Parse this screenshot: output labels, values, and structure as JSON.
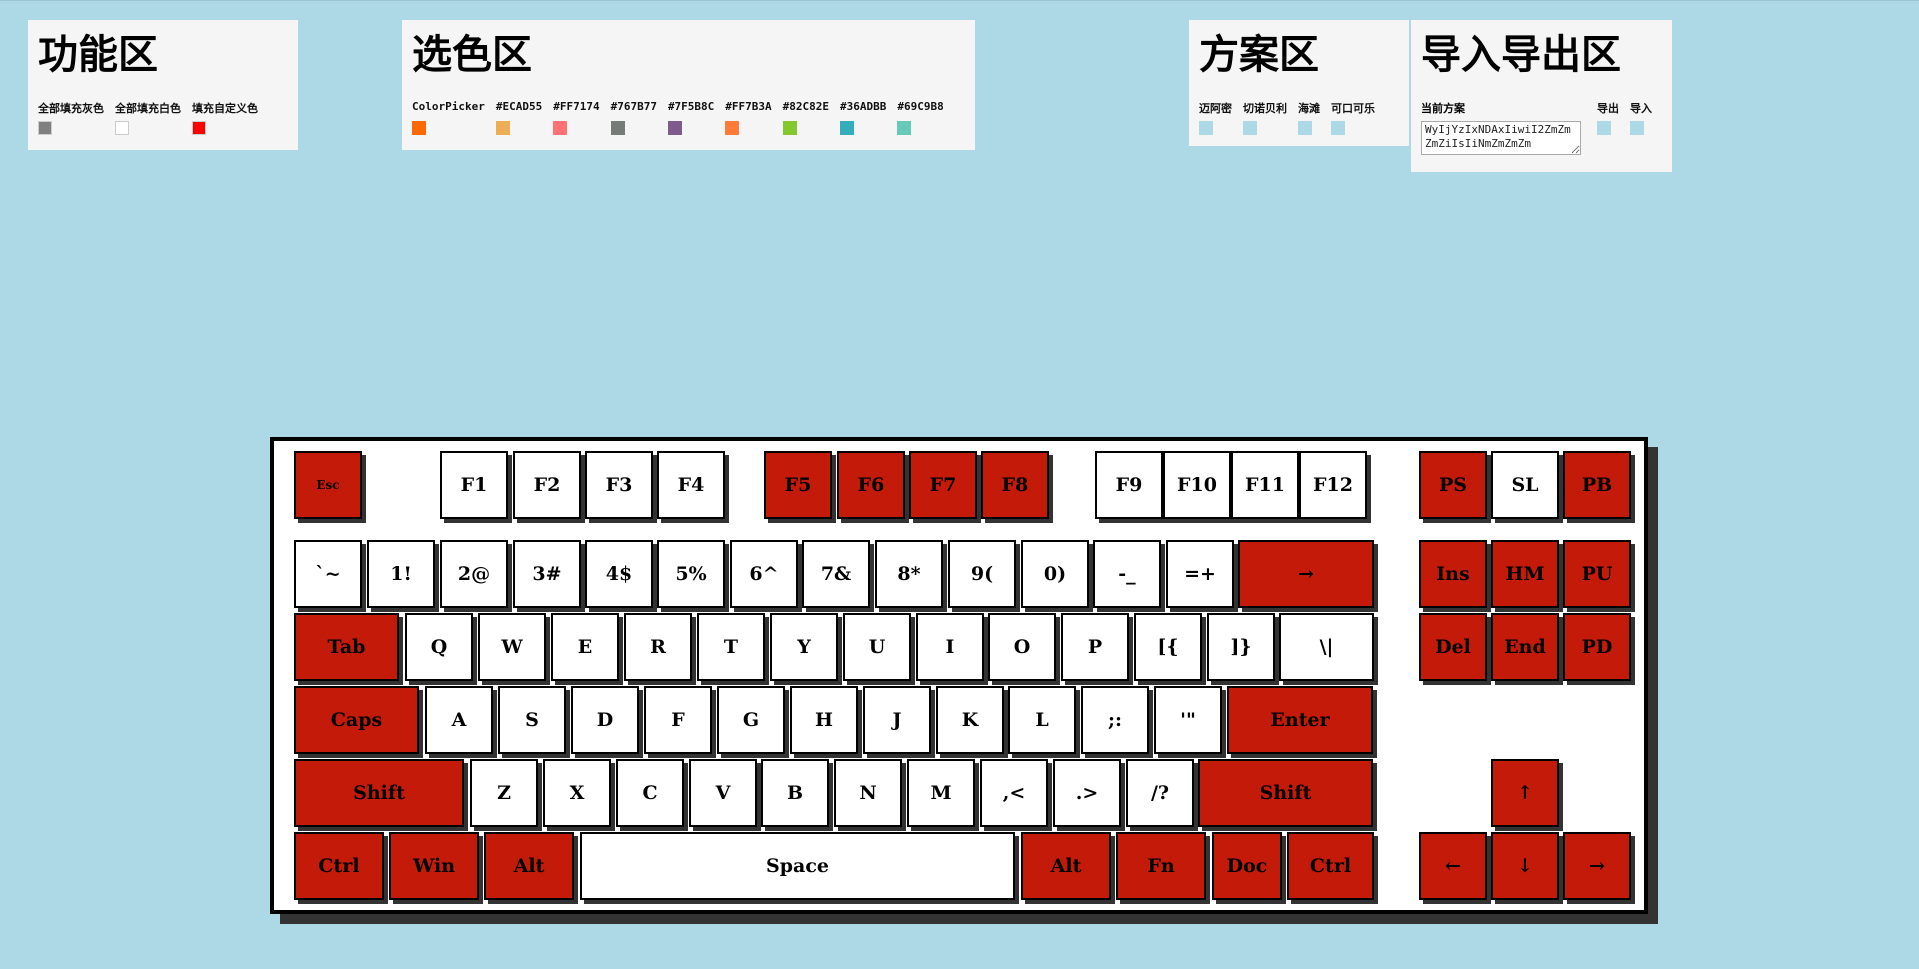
{
  "func_panel": {
    "title": "功能区",
    "items": [
      {
        "label": "全部填充灰色",
        "color": "#808080"
      },
      {
        "label": "全部填充白色",
        "color": "#ffffff"
      },
      {
        "label": "填充自定义色",
        "color": "#ff0000"
      }
    ]
  },
  "color_panel": {
    "title": "选色区",
    "items": [
      {
        "label": "ColorPicker",
        "color": "#ff6a00"
      },
      {
        "label": "#ECAD55",
        "color": "#ECAD55"
      },
      {
        "label": "#FF7174",
        "color": "#FF7174"
      },
      {
        "label": "#767B77",
        "color": "#767B77"
      },
      {
        "label": "#7F5B8C",
        "color": "#7F5B8C"
      },
      {
        "label": "#FF7B3A",
        "color": "#FF7B3A"
      },
      {
        "label": "#82C82E",
        "color": "#82C82E"
      },
      {
        "label": "#36ADBB",
        "color": "#36ADBB"
      },
      {
        "label": "#69C9B8",
        "color": "#69C9B8"
      }
    ]
  },
  "scheme_panel": {
    "title": "方案区",
    "items": [
      {
        "label": "迈阿密",
        "color": "#add8e6"
      },
      {
        "label": "切诺贝利",
        "color": "#add8e6"
      },
      {
        "label": "海滩",
        "color": "#add8e6"
      },
      {
        "label": "可口可乐",
        "color": "#add8e6"
      }
    ]
  },
  "io_panel": {
    "title": "导入导出区",
    "current_label": "当前方案",
    "textarea_value": "WyIjYzIxNDAxIiwiI2ZmZmZmZiIsIiNmZmZmZm",
    "export_label": "导出",
    "import_label": "导入",
    "swatch_color": "#add8e6"
  },
  "colors": {
    "accent_red": "#c31a0a",
    "key_white": "#ffffff",
    "page_bg": "#add8e6"
  },
  "keyboard": {
    "keys": [
      {
        "label": "Esc",
        "color": "red"
      },
      {
        "label": "F1",
        "color": "white"
      },
      {
        "label": "F2",
        "color": "white"
      },
      {
        "label": "F3",
        "color": "white"
      },
      {
        "label": "F4",
        "color": "white"
      },
      {
        "label": "F5",
        "color": "red"
      },
      {
        "label": "F6",
        "color": "red"
      },
      {
        "label": "F7",
        "color": "red"
      },
      {
        "label": "F8",
        "color": "red"
      },
      {
        "label": "F9",
        "color": "white"
      },
      {
        "label": "F10",
        "color": "white"
      },
      {
        "label": "F11",
        "color": "white"
      },
      {
        "label": "F12",
        "color": "white"
      },
      {
        "label": "PS",
        "color": "red"
      },
      {
        "label": "SL",
        "color": "white"
      },
      {
        "label": "PB",
        "color": "red"
      },
      {
        "label": "`~",
        "color": "white"
      },
      {
        "label": "1!",
        "color": "white"
      },
      {
        "label": "2@",
        "color": "white"
      },
      {
        "label": "3#",
        "color": "white"
      },
      {
        "label": "4$",
        "color": "white"
      },
      {
        "label": "5%",
        "color": "white"
      },
      {
        "label": "6^",
        "color": "white"
      },
      {
        "label": "7&",
        "color": "white"
      },
      {
        "label": "8*",
        "color": "white"
      },
      {
        "label": "9(",
        "color": "white"
      },
      {
        "label": "0)",
        "color": "white"
      },
      {
        "label": "-_",
        "color": "white"
      },
      {
        "label": "=+",
        "color": "white"
      },
      {
        "label": "→",
        "color": "red"
      },
      {
        "label": "Ins",
        "color": "red"
      },
      {
        "label": "HM",
        "color": "red"
      },
      {
        "label": "PU",
        "color": "red"
      },
      {
        "label": "Tab",
        "color": "red"
      },
      {
        "label": "Q",
        "color": "white"
      },
      {
        "label": "W",
        "color": "white"
      },
      {
        "label": "E",
        "color": "white"
      },
      {
        "label": "R",
        "color": "white"
      },
      {
        "label": "T",
        "color": "white"
      },
      {
        "label": "Y",
        "color": "white"
      },
      {
        "label": "U",
        "color": "white"
      },
      {
        "label": "I",
        "color": "white"
      },
      {
        "label": "O",
        "color": "white"
      },
      {
        "label": "P",
        "color": "white"
      },
      {
        "label": "[{",
        "color": "white"
      },
      {
        "label": "]}",
        "color": "white"
      },
      {
        "label": "\\|",
        "color": "white"
      },
      {
        "label": "Del",
        "color": "red"
      },
      {
        "label": "End",
        "color": "red"
      },
      {
        "label": "PD",
        "color": "red"
      },
      {
        "label": "Caps",
        "color": "red"
      },
      {
        "label": "A",
        "color": "white"
      },
      {
        "label": "S",
        "color": "white"
      },
      {
        "label": "D",
        "color": "white"
      },
      {
        "label": "F",
        "color": "white"
      },
      {
        "label": "G",
        "color": "white"
      },
      {
        "label": "H",
        "color": "white"
      },
      {
        "label": "J",
        "color": "white"
      },
      {
        "label": "K",
        "color": "white"
      },
      {
        "label": "L",
        "color": "white"
      },
      {
        "label": ";:",
        "color": "white"
      },
      {
        "label": "'\"",
        "color": "white"
      },
      {
        "label": "Enter",
        "color": "red"
      },
      {
        "label": "Shift",
        "color": "red"
      },
      {
        "label": "Z",
        "color": "white"
      },
      {
        "label": "X",
        "color": "white"
      },
      {
        "label": "C",
        "color": "white"
      },
      {
        "label": "V",
        "color": "white"
      },
      {
        "label": "B",
        "color": "white"
      },
      {
        "label": "N",
        "color": "white"
      },
      {
        "label": "M",
        "color": "white"
      },
      {
        "label": ",<",
        "color": "white"
      },
      {
        "label": ".>",
        "color": "white"
      },
      {
        "label": "/?",
        "color": "white"
      },
      {
        "label": "Shift",
        "color": "red"
      },
      {
        "label": "↑",
        "color": "red"
      },
      {
        "label": "Ctrl",
        "color": "red"
      },
      {
        "label": "Win",
        "color": "red"
      },
      {
        "label": "Alt",
        "color": "red"
      },
      {
        "label": "Space",
        "color": "white"
      },
      {
        "label": "Alt",
        "color": "red"
      },
      {
        "label": "Fn",
        "color": "red"
      },
      {
        "label": "Doc",
        "color": "red"
      },
      {
        "label": "Ctrl",
        "color": "red"
      },
      {
        "label": "←",
        "color": "red"
      },
      {
        "label": "↓",
        "color": "red"
      },
      {
        "label": "→",
        "color": "red"
      }
    ]
  }
}
